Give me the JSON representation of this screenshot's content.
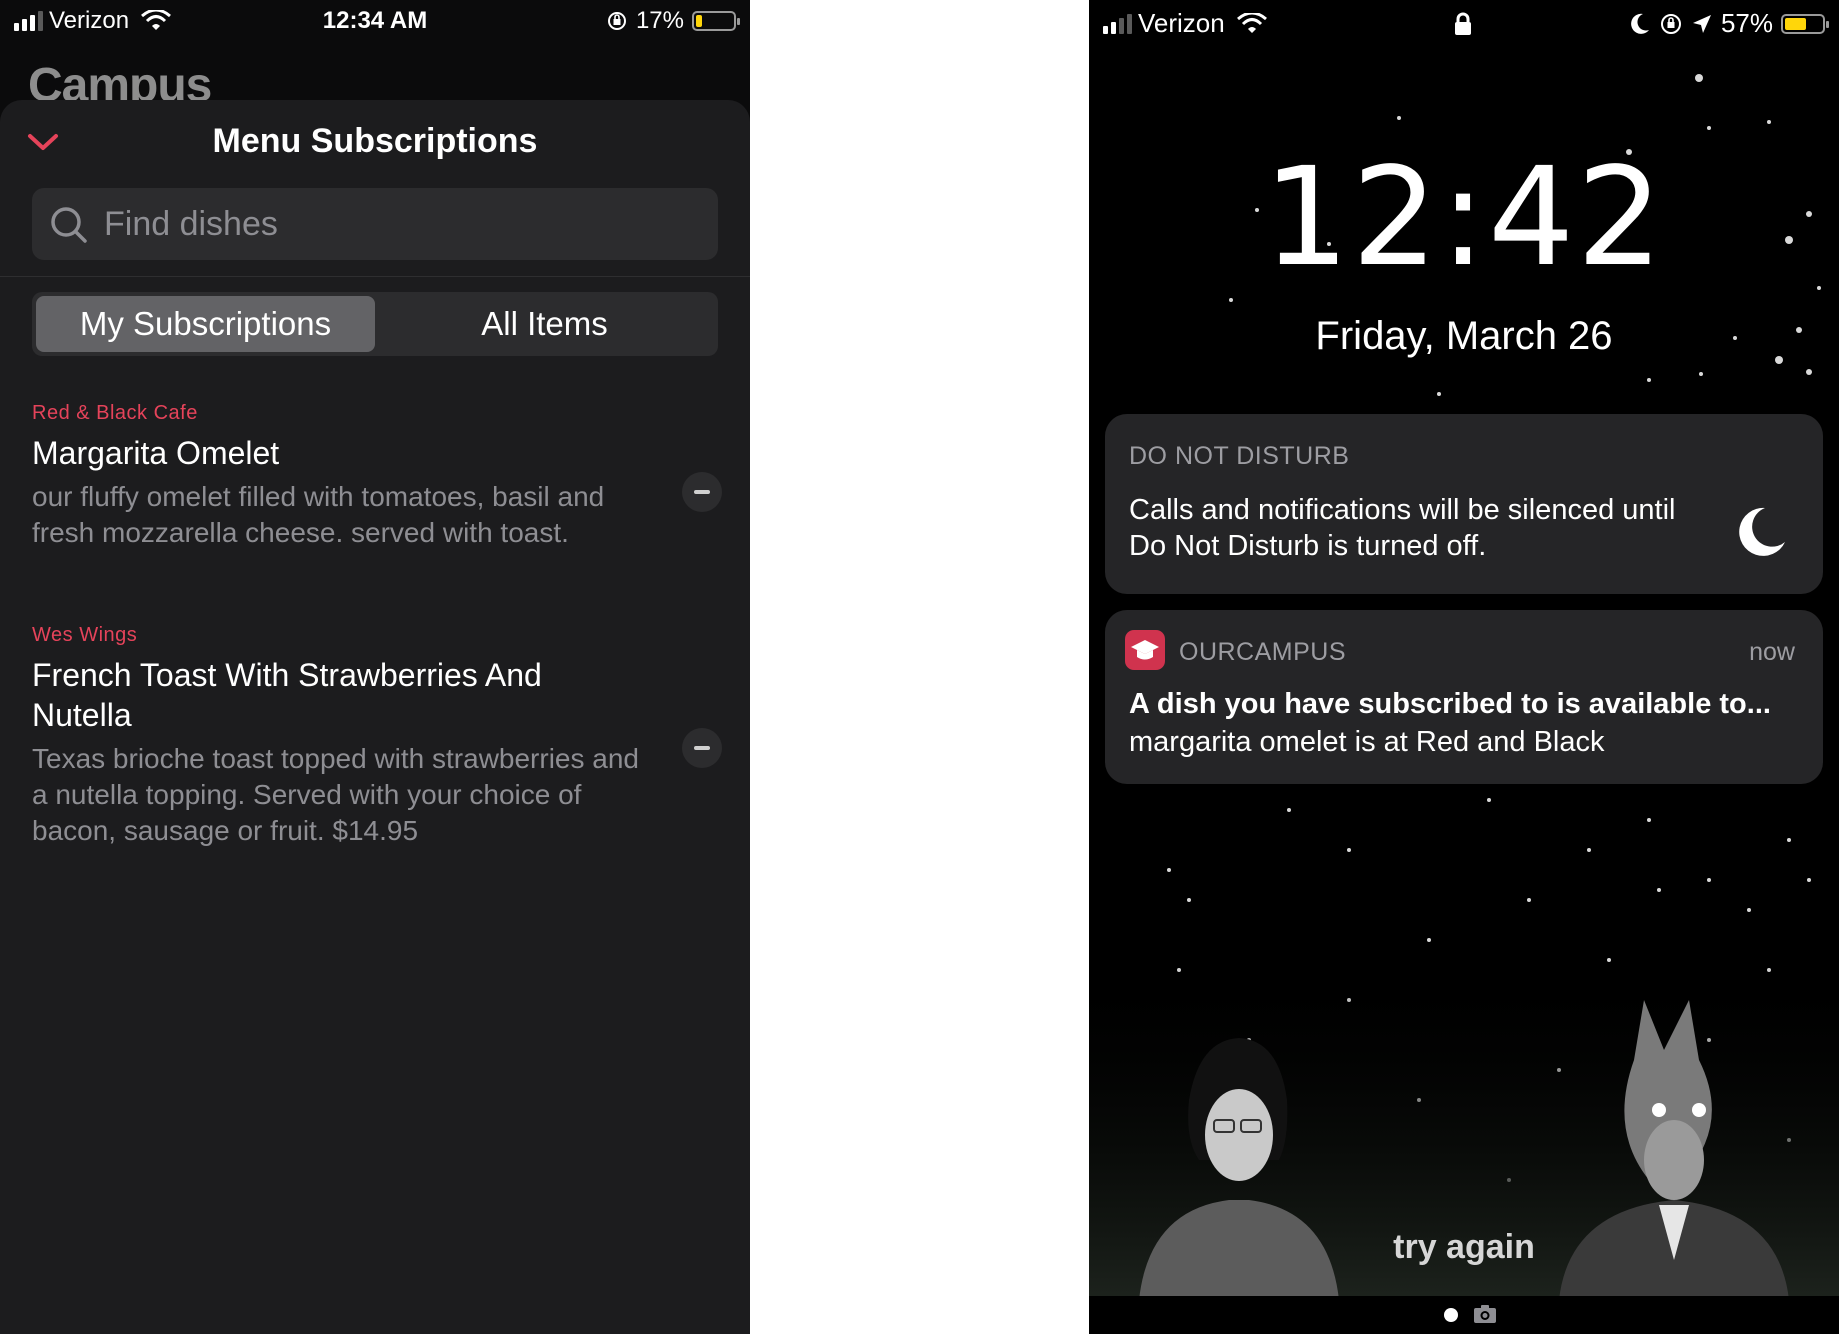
{
  "left_screen": {
    "status": {
      "carrier": "Verizon",
      "time": "12:34 AM",
      "battery_percent": "17%",
      "battery_level": 0.17,
      "battery_color": "#ffd60a"
    },
    "background_title": "Campus",
    "sheet": {
      "title": "Menu Subscriptions",
      "search_placeholder": "Find dishes",
      "search_value": "",
      "segments": [
        {
          "label": "My Subscriptions",
          "selected": true
        },
        {
          "label": "All Items",
          "selected": false
        }
      ],
      "items": [
        {
          "cafe": "Red & Black Cafe",
          "name": "Margarita Omelet",
          "description": "our fluffy omelet filled with tomatoes, basil and fresh mozzarella cheese. served with toast."
        },
        {
          "cafe": "Wes Wings",
          "name": "French Toast With Strawberries And Nutella",
          "description": "Texas brioche toast topped with strawberries and a nutella topping. Served with your choice of bacon, sausage or fruit. $14.95"
        }
      ]
    },
    "accent_color": "#e5435a"
  },
  "right_screen": {
    "status": {
      "carrier": "Verizon",
      "battery_percent": "57%",
      "battery_level": 0.57,
      "battery_color": "#ffd60a"
    },
    "lock_screen": {
      "time": "12:42",
      "date": "Friday, March 26"
    },
    "notifications": [
      {
        "type": "dnd",
        "title": "DO NOT DISTURB",
        "body": "Calls and notifications will be silenced until Do Not Disturb is turned off."
      },
      {
        "type": "app",
        "app_name": "OURCAMPUS",
        "time": "now",
        "title": "A dish you have subscribed to is available to...",
        "body": "margarita omelet is at Red and Black",
        "icon_color": "#d0334e"
      }
    ],
    "wallpaper_caption": "try again"
  }
}
